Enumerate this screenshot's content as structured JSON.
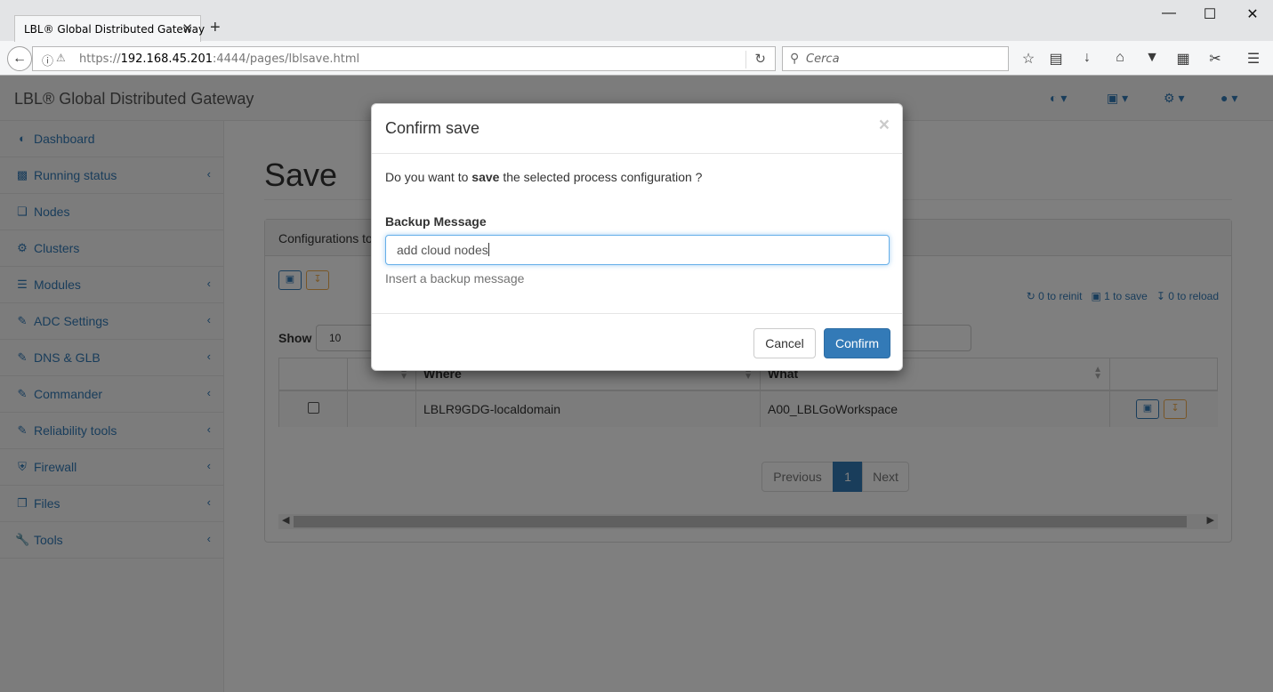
{
  "browser": {
    "tab_title": "LBL® Global Distributed Gateway",
    "tab_close": "✕",
    "new_tab": "+",
    "url_prefix": "https://",
    "url_host": "192.168.45.201",
    "url_rest": ":4444/pages/lblsave.html",
    "search_placeholder": "Cerca",
    "window_controls": [
      "minimize",
      "maximize",
      "close"
    ]
  },
  "app": {
    "brand": "LBL® Global Distributed Gateway",
    "nav_dropdowns": [
      "dashboard-icon",
      "save-icon",
      "gear-icon",
      "user-icon"
    ]
  },
  "sidebar": {
    "items": [
      {
        "label": "Dashboard",
        "icon": "dashboard-icon",
        "has_arrow": false
      },
      {
        "label": "Running status",
        "icon": "bar-chart-icon",
        "has_arrow": true
      },
      {
        "label": "Nodes",
        "icon": "cube-icon",
        "has_arrow": false
      },
      {
        "label": "Clusters",
        "icon": "cogs-icon",
        "has_arrow": false
      },
      {
        "label": "Modules",
        "icon": "list-icon",
        "has_arrow": true
      },
      {
        "label": "ADC Settings",
        "icon": "edit-icon",
        "has_arrow": true
      },
      {
        "label": "DNS & GLB",
        "icon": "edit-icon",
        "has_arrow": true
      },
      {
        "label": "Commander",
        "icon": "edit-icon",
        "has_arrow": true
      },
      {
        "label": "Reliability tools",
        "icon": "edit-icon",
        "has_arrow": true
      },
      {
        "label": "Firewall",
        "icon": "shield-icon",
        "has_arrow": true
      },
      {
        "label": "Files",
        "icon": "files-icon",
        "has_arrow": true
      },
      {
        "label": "Tools",
        "icon": "wrench-icon",
        "has_arrow": true
      }
    ]
  },
  "main": {
    "title": "Save",
    "panel_title": "Configurations to",
    "counters": {
      "reinit": "0 to reinit",
      "save": "1 to save",
      "reload": "0 to reload"
    },
    "show_label": "Show",
    "show_value": "10",
    "table": {
      "headers": [
        "",
        "",
        "Where",
        "What",
        ""
      ],
      "rows": [
        {
          "where": "LBLR9GDG-localdomain",
          "what": "A00_LBLGoWorkspace"
        }
      ]
    },
    "pagination": {
      "previous": "Previous",
      "current": "1",
      "next": "Next"
    }
  },
  "modal": {
    "title": "Confirm save",
    "close": "×",
    "question_pre": "Do you want to ",
    "question_bold": "save",
    "question_post": " the selected process configuration ?",
    "field_label": "Backup Message",
    "field_value": "add cloud nodes",
    "help": "Insert a backup message",
    "cancel": "Cancel",
    "confirm": "Confirm"
  },
  "colors": {
    "primary": "#337ab7",
    "warning": "#f0ad4e",
    "overlay": "rgba(0,0,0,0.5)"
  }
}
